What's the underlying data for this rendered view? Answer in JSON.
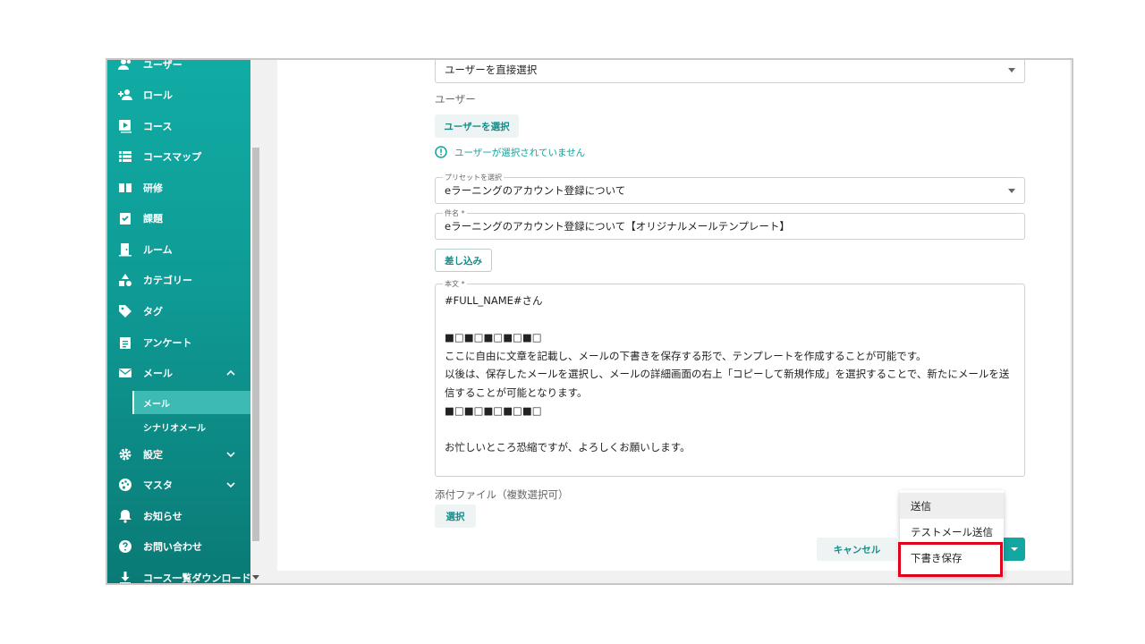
{
  "sidebar": {
    "items": [
      {
        "label": "ユーザー",
        "icon": "users-icon"
      },
      {
        "label": "ロール",
        "icon": "person-add-icon"
      },
      {
        "label": "コース",
        "icon": "play-icon"
      },
      {
        "label": "コースマップ",
        "icon": "list-icon"
      },
      {
        "label": "研修",
        "icon": "book-icon"
      },
      {
        "label": "課題",
        "icon": "clipboard-check-icon"
      },
      {
        "label": "ルーム",
        "icon": "door-icon"
      },
      {
        "label": "カテゴリー",
        "icon": "shapes-icon"
      },
      {
        "label": "タグ",
        "icon": "tag-icon"
      },
      {
        "label": "アンケート",
        "icon": "clipboard-icon"
      },
      {
        "label": "メール",
        "icon": "mail-icon"
      },
      {
        "label": "設定",
        "icon": "gear-icon"
      },
      {
        "label": "マスタ",
        "icon": "palette-icon"
      },
      {
        "label": "お知らせ",
        "icon": "bell-icon"
      },
      {
        "label": "お問い合わせ",
        "icon": "help-icon"
      },
      {
        "label": "コース一覧ダウンロード",
        "icon": "download-icon"
      }
    ],
    "mail_sub": [
      {
        "label": "メール"
      },
      {
        "label": "シナリオメール"
      }
    ]
  },
  "form": {
    "recipient_mode": "ユーザーを直接選択",
    "user_label": "ユーザー",
    "select_user_button": "ユーザーを選択",
    "no_user_warning": "ユーザーが選択されていません",
    "preset_label": "プリセットを選択",
    "preset_value": "eラーニングのアカウント登録について",
    "subject_label": "件名 *",
    "subject_value": "eラーニングのアカウント登録について【オリジナルメールテンプレート】",
    "insert_button": "差し込み",
    "body_label": "本文 *",
    "body_lines": [
      "#FULL_NAME#さん",
      "",
      "■□■□■□■□■□",
      "ここに自由に文章を記載し、メールの下書きを保存する形で、テンプレートを作成することが可能です。",
      "以後は、保存したメールを選択し、メールの詳細画面の右上「コピーして新規作成」を選択することで、新たにメールを送",
      "信することが可能となります。",
      "■□■□■□■□■□",
      "",
      "お忙しいところ恐縮ですが、よろしくお願いします。"
    ],
    "attachment_label": "添付ファイル（複数選択可）",
    "attachment_button": "選択",
    "cancel_button": "キャンセル"
  },
  "send_menu": {
    "items": [
      "送信",
      "テストメール送信",
      "下書き保存"
    ]
  },
  "colors": {
    "accent": "#13a39c",
    "highlight": "#e0001b"
  }
}
